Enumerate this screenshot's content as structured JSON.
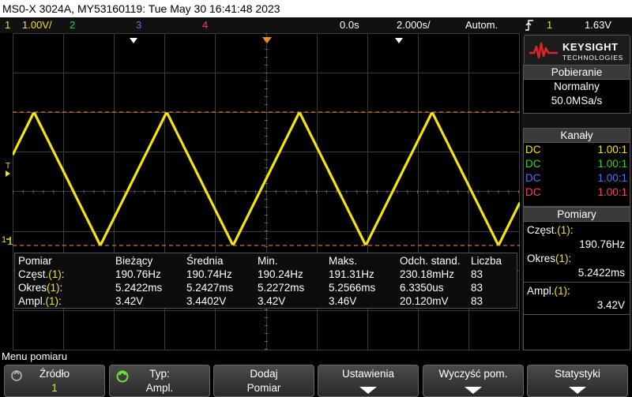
{
  "title_bar": "MS0-X 3024A, MY53160119: Tue May 30 16:41:48 2023",
  "status_bar": {
    "ch1_num": "1",
    "ch1_scale": "1.00V/",
    "ch2_num": "2",
    "ch3_num": "3",
    "ch4_num": "4",
    "time_offset": "0.0s",
    "time_scale": "2.000s/",
    "trigger_mode": "Autom.",
    "trigger_edge_icon": "rising-edge-icon",
    "trigger_source": "1",
    "trigger_level": "1.63V"
  },
  "markers": {
    "trigger_marker": "T",
    "ground_marker": "1"
  },
  "measurements": {
    "headers": [
      "Pomiar",
      "Bieżący",
      "Średnia",
      "Min.",
      "Maks.",
      "Odch. stand.",
      "Liczba"
    ],
    "rows": [
      {
        "name": "Częst.",
        "ch": "(1)",
        "suffix": ":",
        "values": [
          "190.76Hz",
          "190.74Hz",
          "190.24Hz",
          "191.31Hz",
          "230.18mHz",
          "83"
        ]
      },
      {
        "name": "Okres",
        "ch": "(1)",
        "suffix": ":",
        "values": [
          "5.2422ms",
          "5.2427ms",
          "5.2272ms",
          "5.2566ms",
          "6.3350us",
          "83"
        ]
      },
      {
        "name": "Ampl.",
        "ch": "(1)",
        "suffix": ":",
        "values": [
          "3.42V",
          "3.4402V",
          "3.42V",
          "3.46V",
          "20.120mV",
          "83"
        ]
      }
    ]
  },
  "waveform": {
    "ch1_color": "#f4e40c",
    "cursor_color": "#d7722c",
    "frequency_hz": 190.76,
    "amplitude_v": 3.42,
    "shape": "triangle"
  },
  "right_panel": {
    "logo_brand": "KEYSIGHT",
    "logo_sub": "TECHNOLOGIES",
    "acq_header": "Pobieranie",
    "acq_mode": "Normalny",
    "acq_rate": "50.0MSa/s",
    "channels_header": "Kanały",
    "channels": [
      {
        "coupling": "DC",
        "probe": "1.00:1",
        "color": "#f4e40c"
      },
      {
        "coupling": "DC",
        "probe": "1.00:1",
        "color": "#36d130"
      },
      {
        "coupling": "DC",
        "probe": "1.00:1",
        "color": "#5a6cff"
      },
      {
        "coupling": "DC",
        "probe": "1.00:1",
        "color": "#ff3b6a"
      }
    ],
    "meas_header": "Pomiary",
    "meas_items": [
      {
        "name": "Częst.",
        "ch": "(1)",
        "suffix": ":",
        "value": "190.76Hz"
      },
      {
        "name": "Okres",
        "ch": "(1)",
        "suffix": ":",
        "value": "5.2422ms"
      },
      {
        "name": "Ampl.",
        "ch": "(1)",
        "suffix": ":",
        "value": "3.42V"
      }
    ]
  },
  "menu": {
    "title": "Menu pomiaru",
    "softkeys": [
      {
        "label": "Źródło",
        "value": "1"
      },
      {
        "label": "Typ:",
        "value": "Ampl."
      },
      {
        "label": "Dodaj",
        "value": "Pomiar"
      },
      {
        "label": "Ustawienia",
        "value": ""
      },
      {
        "label": "Wyczyść pom.",
        "value": ""
      },
      {
        "label": "Statystyki",
        "value": ""
      }
    ]
  }
}
